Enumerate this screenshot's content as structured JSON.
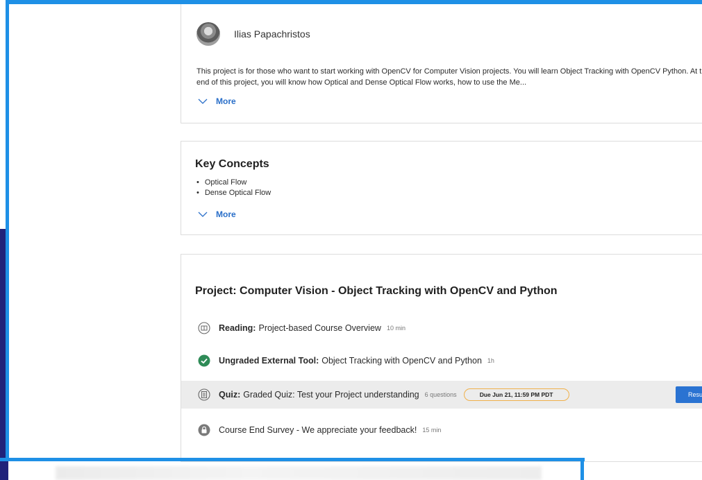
{
  "instructor": {
    "name": "Ilias Papachristos",
    "description": "This project is for those who want to start working with OpenCV for Computer Vision projects. You will learn Object Tracking with OpenCV Python. At the end of this project, you will know how Optical and Dense Optical Flow works, how to use the Me...",
    "more_label": "More"
  },
  "key_concepts": {
    "title": "Key Concepts",
    "items": [
      "Optical Flow",
      "Dense Optical Flow"
    ],
    "more_label": "More"
  },
  "project": {
    "title": "Project: Computer Vision - Object Tracking with OpenCV and Python",
    "items": [
      {
        "type_label": "Reading:",
        "title": "Project-based Course Overview",
        "meta": "10 min",
        "icon": "reading-icon"
      },
      {
        "type_label": "Ungraded External Tool:",
        "title": "Object Tracking with OpenCV and Python",
        "meta": "1h",
        "icon": "check-circle-icon"
      },
      {
        "type_label": "Quiz:",
        "title": "Graded Quiz: Test your Project understanding",
        "meta": "6 questions",
        "due": "Due Jun 21, 11:59 PM PDT",
        "action_label": "Resu",
        "icon": "quiz-icon"
      },
      {
        "type_label": "",
        "title": "Course End Survey - We appreciate your feedback!",
        "meta": "15 min",
        "icon": "lock-icon"
      }
    ]
  },
  "colors": {
    "accent": "#1e90e6",
    "link": "#2a6fc9",
    "success": "#2e8b57",
    "due_border": "#f0b04a",
    "button": "#2a73d2"
  }
}
